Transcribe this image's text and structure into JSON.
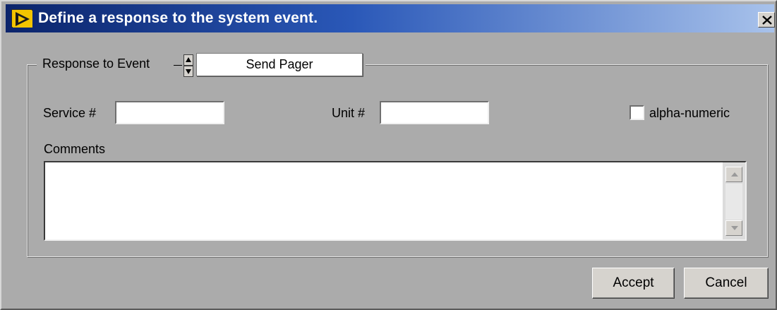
{
  "window": {
    "title": "Define a response to the system event.",
    "close_glyph": "✕",
    "app_icon": "labview-vi-icon",
    "colors": {
      "titlebar_start": "#0b246b",
      "titlebar_end": "#a8c2eb",
      "panel": "#ababab"
    }
  },
  "response": {
    "group_label": "Response to Event",
    "selected": "Send Pager"
  },
  "fields": {
    "service_label": "Service #",
    "service_value": "",
    "unit_label": "Unit #",
    "unit_value": "",
    "alpha_numeric_label": "alpha-numeric",
    "alpha_numeric_checked": false,
    "comments_label": "Comments",
    "comments_value": ""
  },
  "buttons": {
    "accept": "Accept",
    "cancel": "Cancel"
  }
}
